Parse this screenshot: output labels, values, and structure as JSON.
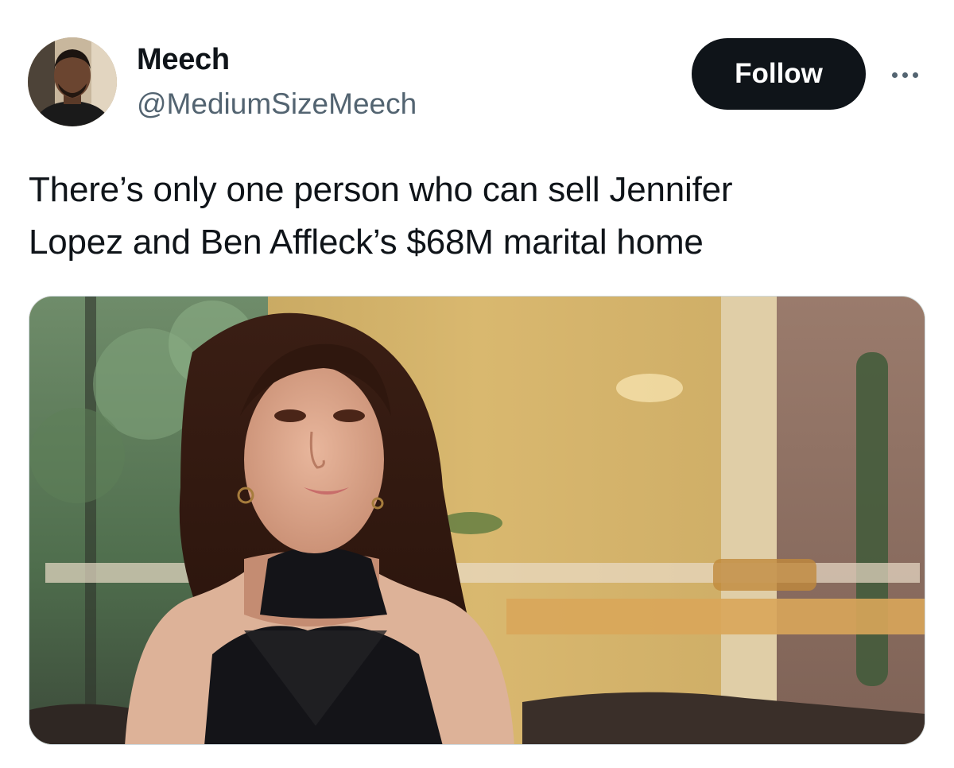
{
  "author": {
    "display_name": "Meech",
    "handle": "@MediumSizeMeech"
  },
  "actions": {
    "follow_label": "Follow",
    "more_icon": "ellipsis-horizontal-icon"
  },
  "tweet": {
    "text_line_1": "There’s only one person who can sell Jennifer",
    "text_line_2": "Lopez and Ben Affleck’s $68M marital home"
  },
  "colors": {
    "text_primary": "#0f1419",
    "text_secondary": "#536471",
    "follow_button_bg": "#0f1419",
    "follow_button_text": "#ffffff",
    "media_border": "#cfd9de"
  }
}
